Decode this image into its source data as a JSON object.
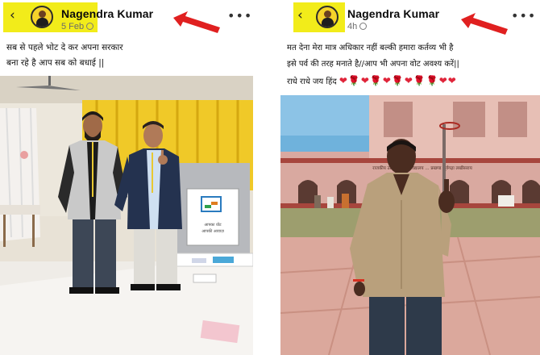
{
  "posts": [
    {
      "author": "Nagendra Kumar",
      "time": "5 Feb",
      "caption_lines": [
        "सब से पहले भोट दे कर अपना सरकार",
        "बना रहे है आप सब को बधाई ||"
      ],
      "sign_text": [
        "आपका वोट",
        "आपकी आवाज़"
      ]
    },
    {
      "author": "Nagendra Kumar",
      "time": "4h",
      "caption_lines": [
        "मत देना मेरा मात्र अधिकार नहीं बल्की हमारा कर्तव्य भी है",
        "इसे पर्व की तरह मनाते है//आप भी अपना वोट अवश्य करें||"
      ],
      "caption_line3": "राधे राधे जय हिंद",
      "hearts": "❤🌹❤🌹❤🌹❤🌹🌹❤❤",
      "banner_text": "राजकीय उत्क्रमित मध्य विद्यालय ... प्रखण्ड सूर्यगढ़ा लखीसराय"
    }
  ],
  "icons": {
    "back": "‹",
    "more": "•••",
    "arrow": "red-arrow-icon",
    "globe": "globe-icon"
  },
  "colors": {
    "highlight": "#f2ec1a",
    "arrow": "#e02020",
    "heart": "#e0253a"
  }
}
